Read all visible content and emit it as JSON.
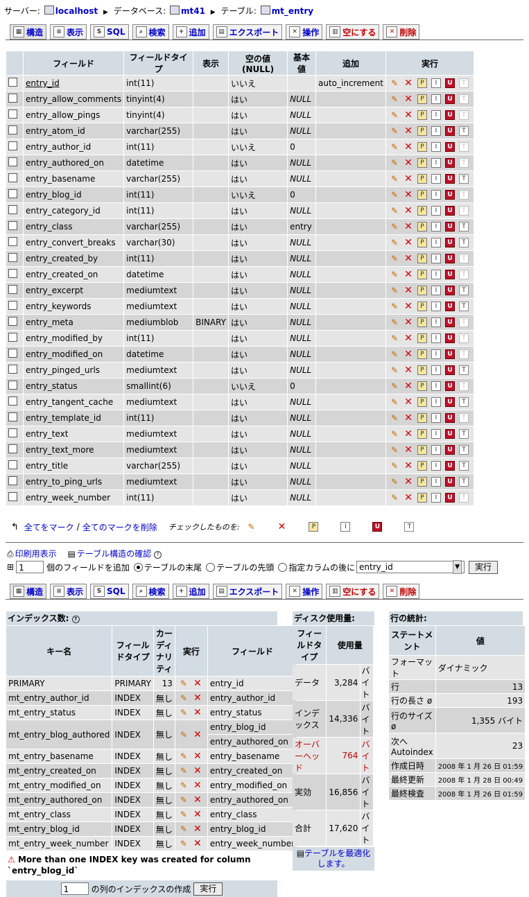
{
  "breadcrumb": {
    "server_label": "サーバー:",
    "server": "localhost",
    "db_label": "データベース:",
    "db": "mt41",
    "table_label": "テーブル:",
    "table": "mt_entry"
  },
  "tabs": [
    "構造",
    "表示",
    "SQL",
    "検索",
    "追加",
    "エクスポート",
    "操作",
    "空にする",
    "削除"
  ],
  "structure": {
    "headers": [
      "フィールド",
      "フィールドタイプ",
      "表示",
      "空の値(NULL)",
      "基本値",
      "追加",
      "実行"
    ],
    "rows": [
      {
        "field": "entry_id",
        "type": "int(11)",
        "attr": "",
        "null": "いいえ",
        "default": "",
        "extra": "auto_increment",
        "ft": false
      },
      {
        "field": "entry_allow_comments",
        "type": "tinyint(4)",
        "attr": "",
        "null": "はい",
        "default": "NULL",
        "extra": "",
        "ft": false
      },
      {
        "field": "entry_allow_pings",
        "type": "tinyint(4)",
        "attr": "",
        "null": "はい",
        "default": "NULL",
        "extra": "",
        "ft": false
      },
      {
        "field": "entry_atom_id",
        "type": "varchar(255)",
        "attr": "",
        "null": "はい",
        "default": "NULL",
        "extra": "",
        "ft": true
      },
      {
        "field": "entry_author_id",
        "type": "int(11)",
        "attr": "",
        "null": "いいえ",
        "default": "0",
        "extra": "",
        "ft": false
      },
      {
        "field": "entry_authored_on",
        "type": "datetime",
        "attr": "",
        "null": "はい",
        "default": "NULL",
        "extra": "",
        "ft": false
      },
      {
        "field": "entry_basename",
        "type": "varchar(255)",
        "attr": "",
        "null": "はい",
        "default": "NULL",
        "extra": "",
        "ft": true
      },
      {
        "field": "entry_blog_id",
        "type": "int(11)",
        "attr": "",
        "null": "いいえ",
        "default": "0",
        "extra": "",
        "ft": false
      },
      {
        "field": "entry_category_id",
        "type": "int(11)",
        "attr": "",
        "null": "はい",
        "default": "NULL",
        "extra": "",
        "ft": false
      },
      {
        "field": "entry_class",
        "type": "varchar(255)",
        "attr": "",
        "null": "はい",
        "default": "entry",
        "extra": "",
        "ft": true
      },
      {
        "field": "entry_convert_breaks",
        "type": "varchar(30)",
        "attr": "",
        "null": "はい",
        "default": "NULL",
        "extra": "",
        "ft": true
      },
      {
        "field": "entry_created_by",
        "type": "int(11)",
        "attr": "",
        "null": "はい",
        "default": "NULL",
        "extra": "",
        "ft": false
      },
      {
        "field": "entry_created_on",
        "type": "datetime",
        "attr": "",
        "null": "はい",
        "default": "NULL",
        "extra": "",
        "ft": false
      },
      {
        "field": "entry_excerpt",
        "type": "mediumtext",
        "attr": "",
        "null": "はい",
        "default": "NULL",
        "extra": "",
        "ft": true
      },
      {
        "field": "entry_keywords",
        "type": "mediumtext",
        "attr": "",
        "null": "はい",
        "default": "NULL",
        "extra": "",
        "ft": true
      },
      {
        "field": "entry_meta",
        "type": "mediumblob",
        "attr": "BINARY",
        "null": "はい",
        "default": "NULL",
        "extra": "",
        "ft": false
      },
      {
        "field": "entry_modified_by",
        "type": "int(11)",
        "attr": "",
        "null": "はい",
        "default": "NULL",
        "extra": "",
        "ft": false
      },
      {
        "field": "entry_modified_on",
        "type": "datetime",
        "attr": "",
        "null": "はい",
        "default": "NULL",
        "extra": "",
        "ft": false
      },
      {
        "field": "entry_pinged_urls",
        "type": "mediumtext",
        "attr": "",
        "null": "はい",
        "default": "NULL",
        "extra": "",
        "ft": true
      },
      {
        "field": "entry_status",
        "type": "smallint(6)",
        "attr": "",
        "null": "いいえ",
        "default": "0",
        "extra": "",
        "ft": false
      },
      {
        "field": "entry_tangent_cache",
        "type": "mediumtext",
        "attr": "",
        "null": "はい",
        "default": "NULL",
        "extra": "",
        "ft": true
      },
      {
        "field": "entry_template_id",
        "type": "int(11)",
        "attr": "",
        "null": "はい",
        "default": "NULL",
        "extra": "",
        "ft": false
      },
      {
        "field": "entry_text",
        "type": "mediumtext",
        "attr": "",
        "null": "はい",
        "default": "NULL",
        "extra": "",
        "ft": true
      },
      {
        "field": "entry_text_more",
        "type": "mediumtext",
        "attr": "",
        "null": "はい",
        "default": "NULL",
        "extra": "",
        "ft": true
      },
      {
        "field": "entry_title",
        "type": "varchar(255)",
        "attr": "",
        "null": "はい",
        "default": "NULL",
        "extra": "",
        "ft": true
      },
      {
        "field": "entry_to_ping_urls",
        "type": "mediumtext",
        "attr": "",
        "null": "はい",
        "default": "NULL",
        "extra": "",
        "ft": true
      },
      {
        "field": "entry_week_number",
        "type": "int(11)",
        "attr": "",
        "null": "はい",
        "default": "NULL",
        "extra": "",
        "ft": false
      }
    ]
  },
  "bottom_ops": {
    "mark_all": "全てをマーク",
    "sep": "/",
    "unmark_all": "全てのマークを削除",
    "with_selected": "チェックしたものを:"
  },
  "links": {
    "print": "印刷用表示",
    "relation": "テーブル構造の確認"
  },
  "add_field": {
    "count": "1",
    "label": "個のフィールドを追加",
    "opt_end": "テーブルの末尾",
    "opt_start": "テーブルの先頭",
    "opt_after": "指定カラムの後に",
    "after_value": "entry_id",
    "go": "実行"
  },
  "indexes": {
    "title": "インデックス数:",
    "headers": [
      "キー名",
      "フィールドタイプ",
      "カーディナリティ",
      "実行",
      "フィールド"
    ],
    "rows": [
      {
        "key": "PRIMARY",
        "type": "PRIMARY",
        "card": "13",
        "fields": [
          "entry_id"
        ]
      },
      {
        "key": "mt_entry_author_id",
        "type": "INDEX",
        "card": "無し",
        "fields": [
          "entry_author_id"
        ]
      },
      {
        "key": "mt_entry_status",
        "type": "INDEX",
        "card": "無し",
        "fields": [
          "entry_status"
        ]
      },
      {
        "key": "mt_entry_blog_authored",
        "type": "INDEX",
        "card": "無し",
        "fields": [
          "entry_blog_id",
          "entry_authored_on"
        ]
      },
      {
        "key": "mt_entry_basename",
        "type": "INDEX",
        "card": "無し",
        "fields": [
          "entry_basename"
        ]
      },
      {
        "key": "mt_entry_created_on",
        "type": "INDEX",
        "card": "無し",
        "fields": [
          "entry_created_on"
        ]
      },
      {
        "key": "mt_entry_modified_on",
        "type": "INDEX",
        "card": "無し",
        "fields": [
          "entry_modified_on"
        ]
      },
      {
        "key": "mt_entry_authored_on",
        "type": "INDEX",
        "card": "無し",
        "fields": [
          "entry_authored_on"
        ]
      },
      {
        "key": "mt_entry_class",
        "type": "INDEX",
        "card": "無し",
        "fields": [
          "entry_class"
        ]
      },
      {
        "key": "mt_entry_blog_id",
        "type": "INDEX",
        "card": "無し",
        "fields": [
          "entry_blog_id"
        ]
      },
      {
        "key": "mt_entry_week_number",
        "type": "INDEX",
        "card": "無し",
        "fields": [
          "entry_week_number"
        ]
      }
    ],
    "warning_line1": "More than one INDEX key was created for column",
    "warning_line2": "`entry_blog_id`",
    "create_count": "1",
    "create_label": "の列のインデックスの作成",
    "create_go": "実行"
  },
  "disk": {
    "title": "ディスク使用量:",
    "headers": [
      "フィールドタイプ",
      "使用量"
    ],
    "rows": [
      {
        "label": "データ",
        "value": "3,284",
        "unit": "バイト",
        "red": false
      },
      {
        "label": "インデックス",
        "value": "14,336",
        "unit": "バイト",
        "red": false
      },
      {
        "label": "オーバーヘッド",
        "value": "764",
        "unit": "バイト",
        "red": true
      },
      {
        "label": "実効",
        "value": "16,856",
        "unit": "バイト",
        "red": false
      },
      {
        "label": "合計",
        "value": "17,620",
        "unit": "バイト",
        "red": false
      }
    ],
    "optimize": "テーブルを最適化します。"
  },
  "stats": {
    "title": "行の統計:",
    "headers": [
      "ステートメント",
      "値"
    ],
    "rows": [
      {
        "label": "フォーマット",
        "value": "ダイナミック",
        "left": true
      },
      {
        "label": "行",
        "value": "13"
      },
      {
        "label": "行の長さ ø",
        "value": "193"
      },
      {
        "label": "行のサイズ ø",
        "value": "1,355 バイト"
      },
      {
        "label": "次へ Autoindex",
        "value": "23"
      },
      {
        "label": "作成日時",
        "value": "2008 年 1 月 26 日 01:59"
      },
      {
        "label": "最終更新",
        "value": "2008 年 1 月 28 日 00:49"
      },
      {
        "label": "最終検査",
        "value": "2008 年 1 月 26 日 01:59"
      }
    ]
  }
}
